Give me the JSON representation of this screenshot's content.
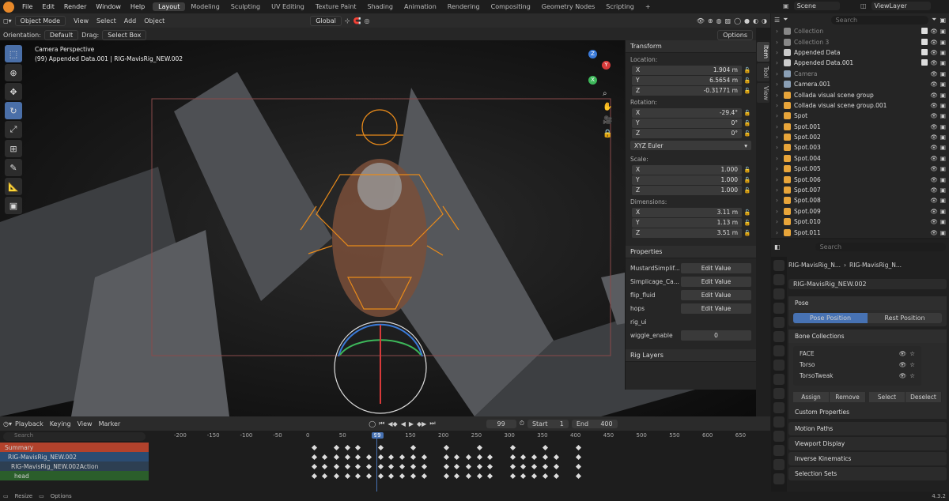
{
  "menu": [
    "File",
    "Edit",
    "Render",
    "Window",
    "Help"
  ],
  "workspaces": [
    {
      "label": "Layout",
      "active": true
    },
    {
      "label": "Modeling"
    },
    {
      "label": "Sculpting"
    },
    {
      "label": "UV Editing"
    },
    {
      "label": "Texture Paint"
    },
    {
      "label": "Shading"
    },
    {
      "label": "Animation"
    },
    {
      "label": "Rendering"
    },
    {
      "label": "Compositing"
    },
    {
      "label": "Geometry Nodes"
    },
    {
      "label": "Scripting"
    }
  ],
  "add_tab": "+",
  "scene": "Scene",
  "view_layer": "ViewLayer",
  "viewport_header": {
    "mode": "Object Mode",
    "menus": [
      "View",
      "Select",
      "Add",
      "Object"
    ],
    "transform": "Global",
    "options": "Options"
  },
  "tool_header": {
    "orientation_label": "Orientation:",
    "orientation": "Default",
    "drag_label": "Drag:",
    "drag": "Select Box"
  },
  "viewport": {
    "camera_label": "Camera Perspective",
    "object_label": "(99) Appended Data.001 | RIG-MavisRig_NEW.002"
  },
  "gizmo": {
    "z": "Z",
    "y": "Y",
    "x": "X"
  },
  "npanel": {
    "transform_title": "Transform",
    "location_label": "Location:",
    "location": [
      {
        "axis": "X",
        "value": "1.904 m"
      },
      {
        "axis": "Y",
        "value": "6.5654 m"
      },
      {
        "axis": "Z",
        "value": "-0.31771 m"
      }
    ],
    "rotation_label": "Rotation:",
    "rotation": [
      {
        "axis": "X",
        "value": "-29.4°"
      },
      {
        "axis": "Y",
        "value": "0°"
      },
      {
        "axis": "Z",
        "value": "0°"
      }
    ],
    "rotation_mode": "XYZ Euler",
    "scale_label": "Scale:",
    "scale": [
      {
        "axis": "X",
        "value": "1.000"
      },
      {
        "axis": "Y",
        "value": "1.000"
      },
      {
        "axis": "Z",
        "value": "1.000"
      }
    ],
    "dimensions_label": "Dimensions:",
    "dimensions": [
      {
        "axis": "X",
        "value": "3.11 m"
      },
      {
        "axis": "Y",
        "value": "1.13 m"
      },
      {
        "axis": "Z",
        "value": "3.51 m"
      }
    ],
    "properties_title": "Properties",
    "properties": [
      {
        "label": "MustardSimplif...",
        "value": "Edit Value"
      },
      {
        "label": "Simplicage_Ca...",
        "value": "Edit Value"
      },
      {
        "label": "flip_fluid",
        "value": "Edit Value"
      },
      {
        "label": "hops",
        "value": "Edit Value"
      },
      {
        "label": "rig_ui",
        "value": ""
      },
      {
        "label": "wiggle_enable",
        "value": "0"
      }
    ],
    "rig_layers_title": "Rig Layers"
  },
  "side_tabs": [
    "Item",
    "Tool",
    "View"
  ],
  "outliner": {
    "search_placeholder": "Search",
    "items": [
      {
        "name": "Collection",
        "dim": true,
        "color": "#888888"
      },
      {
        "name": "Collection 3",
        "dim": true,
        "color": "#888888"
      },
      {
        "name": "Appended Data",
        "color": "#cccccc"
      },
      {
        "name": "Appended Data.001",
        "color": "#cccccc"
      },
      {
        "name": "Camera",
        "dim": true,
        "color": "#8a9fb5"
      },
      {
        "name": "Camera.001",
        "color": "#8a9fb5"
      },
      {
        "name": "Collada visual scene group",
        "color": "#e8a53a"
      },
      {
        "name": "Collada visual scene group.001",
        "color": "#e8a53a"
      },
      {
        "name": "Spot",
        "color": "#e8a53a"
      },
      {
        "name": "Spot.001",
        "color": "#e8a53a"
      },
      {
        "name": "Spot.002",
        "color": "#e8a53a"
      },
      {
        "name": "Spot.003",
        "color": "#e8a53a"
      },
      {
        "name": "Spot.004",
        "color": "#e8a53a"
      },
      {
        "name": "Spot.005",
        "color": "#e8a53a"
      },
      {
        "name": "Spot.006",
        "color": "#e8a53a"
      },
      {
        "name": "Spot.007",
        "color": "#e8a53a"
      },
      {
        "name": "Spot.008",
        "color": "#e8a53a"
      },
      {
        "name": "Spot.009",
        "color": "#e8a53a"
      },
      {
        "name": "Spot.010",
        "color": "#e8a53a"
      },
      {
        "name": "Spot.011",
        "color": "#e8a53a"
      }
    ]
  },
  "properties_editor": {
    "search_placeholder": "Search",
    "breadcrumb_a": "RIG-MavisRig_N...",
    "breadcrumb_b": "RIG-MavisRig_N...",
    "armature_name": "RIG-MavisRig_NEW.002",
    "pose_title": "Pose",
    "pose_position": "Pose Position",
    "rest_position": "Rest Position",
    "bone_collections_title": "Bone Collections",
    "bone_collections": [
      "FACE",
      "Torso",
      "TorsoTweak"
    ],
    "buttons": [
      "Assign",
      "Remove",
      "Select",
      "Deselect"
    ],
    "custom_properties": "Custom Properties",
    "sections": [
      "Motion Paths",
      "Viewport Display",
      "Inverse Kinematics",
      "Selection Sets"
    ]
  },
  "timeline": {
    "menus": [
      "Playback",
      "Keying",
      "View",
      "Marker"
    ],
    "current_frame": "99",
    "start_label": "Start",
    "start": "1",
    "end_label": "End",
    "end": "400",
    "search_placeholder": "Search",
    "ruler": [
      "-200",
      "-150",
      "-100",
      "-50",
      "0",
      "50",
      "99",
      "150",
      "200",
      "250",
      "300",
      "350",
      "400",
      "450",
      "500",
      "550",
      "600",
      "650"
    ],
    "channels": [
      {
        "label": "Summary",
        "color": "#b2422c"
      },
      {
        "label": "RIG-MavisRig_NEW.002",
        "color": "#2b4c72"
      },
      {
        "label": "RIG-MavisRig_NEW.002Action",
        "color": "#2d3f52"
      },
      {
        "label": "head",
        "color": "#2b5e2b"
      }
    ]
  },
  "status": {
    "left": "Resize",
    "options": "Options",
    "version": "4.3.2"
  }
}
